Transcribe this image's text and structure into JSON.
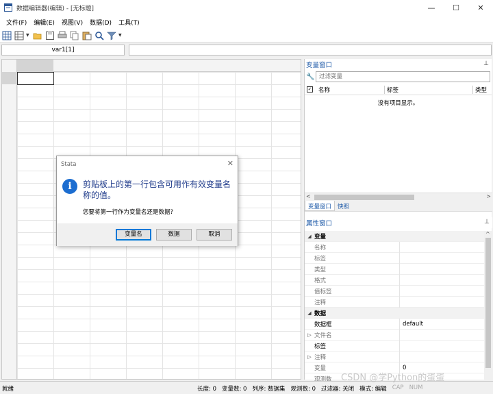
{
  "window": {
    "title": "数据编辑器(编辑) - [无标题]",
    "minimize": "—",
    "maximize": "☐",
    "close": "✕"
  },
  "menu": [
    "文件(F)",
    "编辑(E)",
    "视图(V)",
    "数据(D)",
    "工具(T)"
  ],
  "toolbar": {
    "icons": [
      "data-editor-edit-icon",
      "data-editor-browse-icon",
      "open-icon",
      "save-icon",
      "print-icon",
      "copy-icon",
      "paste-icon",
      "find-icon",
      "filter-icon"
    ]
  },
  "cell": {
    "ref": "var1[1]",
    "value": ""
  },
  "variables_pane": {
    "title": "变量窗口",
    "filter_placeholder": "过滤变量",
    "columns": [
      "名称",
      "标签",
      "类型"
    ],
    "empty_message": "没有项目显示。",
    "tabs": [
      "变量窗口",
      "快照"
    ]
  },
  "properties_pane": {
    "title": "属性窗口",
    "rows": [
      {
        "type": "group",
        "key": "变量"
      },
      {
        "type": "item",
        "key": "名称",
        "value": ""
      },
      {
        "type": "item",
        "key": "标签",
        "value": ""
      },
      {
        "type": "item",
        "key": "类型",
        "value": ""
      },
      {
        "type": "item",
        "key": "格式",
        "value": ""
      },
      {
        "type": "item",
        "key": "值标签",
        "value": ""
      },
      {
        "type": "item",
        "key": "注释",
        "value": ""
      },
      {
        "type": "group",
        "key": "数据"
      },
      {
        "type": "item",
        "key": "数据框",
        "value": "default",
        "dark": true
      },
      {
        "type": "item",
        "key": "文件名",
        "value": "",
        "expand": true
      },
      {
        "type": "item",
        "key": "标签",
        "value": "",
        "dark": true
      },
      {
        "type": "item",
        "key": "注释",
        "value": "",
        "expand": true
      },
      {
        "type": "item",
        "key": "变量",
        "value": "0"
      },
      {
        "type": "item",
        "key": "观测数",
        "value": ""
      }
    ]
  },
  "dialog": {
    "title": "Stata",
    "message": "剪贴板上的第一行包含可用作有效变量名称的值。",
    "question": "您要将第一行作为变量名还是数据?",
    "buttons": {
      "varname": "变量名",
      "data": "数据",
      "cancel": "取消"
    }
  },
  "status": {
    "ready": "就绪",
    "items": [
      "长度: 0",
      "变量数: 0",
      "列序: 数据集",
      "观测数: 0",
      "过滤器: 关闭",
      "模式: 编辑"
    ],
    "dim_items": [
      "CAP",
      "NUM"
    ]
  },
  "watermark": "CSDN @学Python的蛋蛋"
}
